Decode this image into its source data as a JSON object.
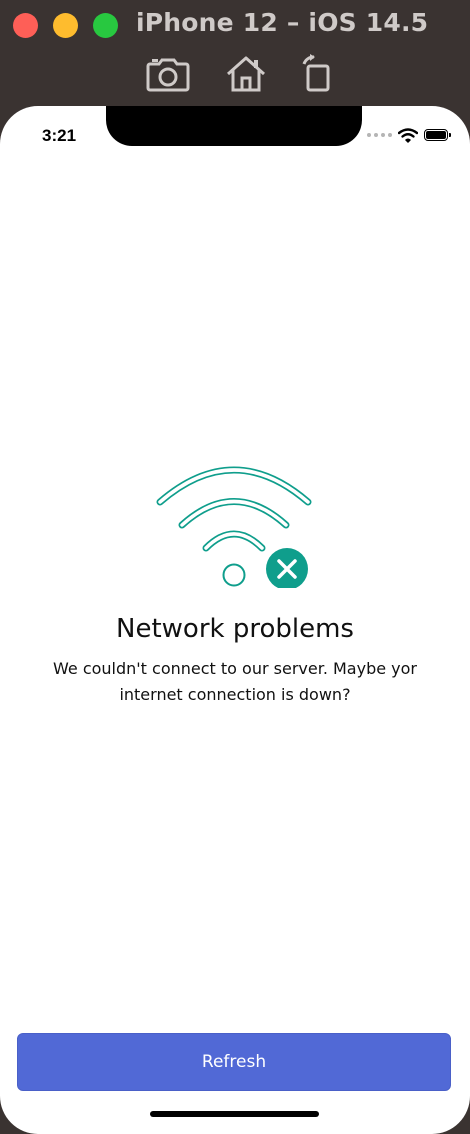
{
  "window": {
    "title": "iPhone 12 – iOS 14.5",
    "toolbar": {
      "screenshot_icon": "camera-icon",
      "home_icon": "home-icon",
      "rotate_icon": "rotate-icon"
    }
  },
  "status_bar": {
    "time": "3:21"
  },
  "error_screen": {
    "icon": "wifi-off-icon",
    "title": "Network problems",
    "message": "We couldn't connect to our server. Maybe yor internet connection is down?",
    "accent_color": "#0f9e8c"
  },
  "actions": {
    "refresh_label": "Refresh",
    "button_color": "#5169d6"
  }
}
